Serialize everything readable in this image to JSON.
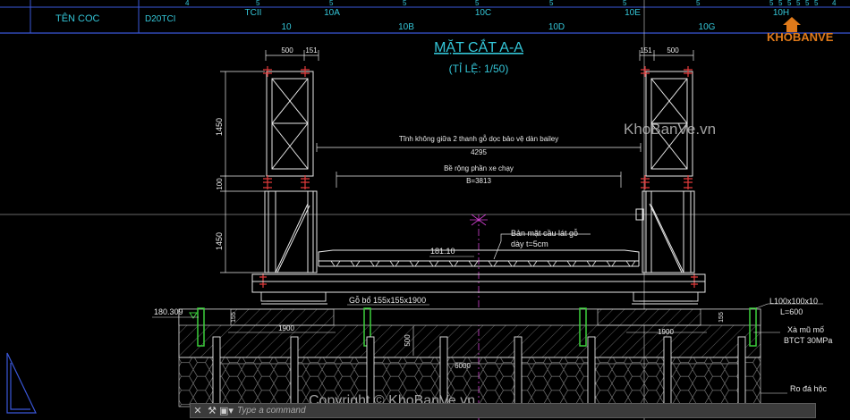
{
  "header": {
    "label": "TÊN COC",
    "value": "D20TCI",
    "row1_marks": [
      "4",
      "5",
      "5",
      "5",
      "5",
      "5",
      "5",
      "5",
      "5",
      "5",
      "5",
      "5",
      "5",
      "5",
      "4"
    ],
    "row2_names": [
      "TCII",
      "10A",
      "10C",
      "10E",
      "10H"
    ],
    "row3_names": [
      "10",
      "10B",
      "10D",
      "10G"
    ]
  },
  "drawing": {
    "title": "MẶT CẮT A-A",
    "scale": "(TỈ LỆ: 1/50)",
    "dim_500_left": "500",
    "dim_151_left": "151",
    "dim_151_right": "151",
    "dim_500_right": "500",
    "dim_1450_top": "1450",
    "dim_100": "100",
    "dim_1450_bot": "1450",
    "clear_width_note": "Tĩnh không giữa 2 thanh gỗ dọc bảo vệ dàn bailey",
    "clear_width_value": "4295",
    "lane_width_note": "Bề rộng phần xe chạy",
    "lane_width_value": "B=3813",
    "deck_note_1": "Bản mặt cầu lát gỗ",
    "deck_note_2": "dày t=5cm",
    "elev_deck": "181.10",
    "elev_left": "180.309",
    "timber_block": "Gỗ bổ 155x155x1900",
    "dim_155": "155",
    "dim_1900_left": "1900",
    "dim_1900_right": "1900",
    "dim_500_vert": "500",
    "dim_6000": "6000",
    "angle_note_1": "L100x100x10",
    "angle_note_2": "L=600",
    "cap_note_1": "Xà mũ mố",
    "cap_note_2": "BTCT 30MPa",
    "rock_note": "Ro đá hộc"
  },
  "watermarks": {
    "site": "KhoBanVe.vn",
    "copyright": "Copyright © KhoBanVe.vn",
    "logo_text": "KHOBANVE"
  },
  "commandline": {
    "placeholder": "Type a command"
  },
  "colors": {
    "cyan": "#34c6d8",
    "white": "#e8e8e8",
    "red": "#e23b3b",
    "magenta": "#d040d0",
    "green": "#3ccf3c",
    "blue_frame": "#3a57d9",
    "gray_hatch": "#8a8a8a"
  }
}
